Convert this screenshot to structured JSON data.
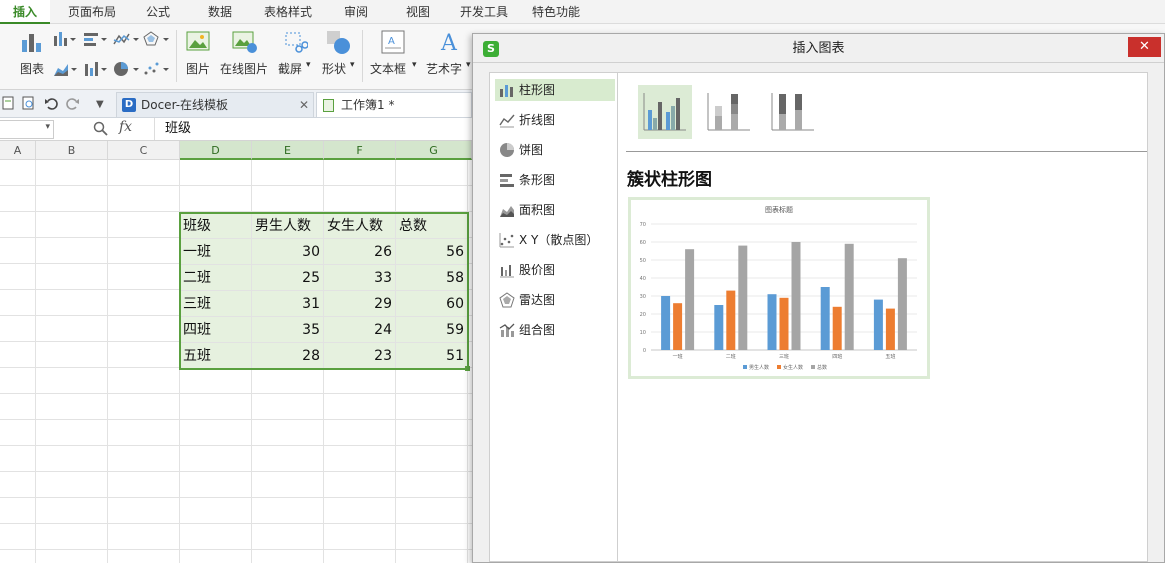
{
  "menu_tabs": [
    "插入",
    "页面布局",
    "公式",
    "数据",
    "表格样式",
    "审阅",
    "视图",
    "开发工具",
    "特色功能"
  ],
  "ribbon": {
    "chart_label": "图表",
    "picture_label": "图片",
    "online_picture_label": "在线图片",
    "screenshot_label": "截屏",
    "shapes_label": "形状",
    "textbox_label": "文本框",
    "wordart_label": "艺术字"
  },
  "file_tabs": {
    "docer": "Docer-在线模板",
    "workbook": "工作簿1 *"
  },
  "formula": {
    "fx": "fx",
    "value": "班级"
  },
  "column_headers": [
    "A",
    "B",
    "C",
    "D",
    "E",
    "F",
    "G"
  ],
  "table": {
    "headers": [
      "班级",
      "男生人数",
      "女生人数",
      "总数"
    ],
    "rows": [
      [
        "一班",
        "30",
        "26",
        "56"
      ],
      [
        "二班",
        "25",
        "33",
        "58"
      ],
      [
        "三班",
        "31",
        "29",
        "60"
      ],
      [
        "四班",
        "35",
        "24",
        "59"
      ],
      [
        "五班",
        "28",
        "23",
        "51"
      ]
    ]
  },
  "dialog": {
    "title": "插入图表",
    "chart_types": [
      "柱形图",
      "折线图",
      "饼图",
      "条形图",
      "面积图",
      "X Y（散点图）",
      "股价图",
      "雷达图",
      "组合图"
    ],
    "selected_type_index": 0,
    "subtype_title": "簇状柱形图",
    "close_icon": "close-icon"
  },
  "chart_data": {
    "type": "bar",
    "title": "图表标题",
    "categories": [
      "一班",
      "二班",
      "三班",
      "四班",
      "五班"
    ],
    "series": [
      {
        "name": "男生人数",
        "values": [
          30,
          25,
          31,
          35,
          28
        ]
      },
      {
        "name": "女生人数",
        "values": [
          26,
          33,
          29,
          24,
          23
        ]
      },
      {
        "name": "总数",
        "values": [
          56,
          58,
          60,
          59,
          51
        ]
      }
    ],
    "ylim": [
      0,
      70
    ],
    "yticks": [
      "0",
      "10",
      "20",
      "30",
      "40",
      "50",
      "60",
      "70"
    ],
    "grid": true,
    "legend": "bottom",
    "colors": [
      "#5b9bd5",
      "#ed7d31",
      "#a5a5a5"
    ]
  },
  "colors": {
    "accent": "#3a8a28",
    "selection_fill": "#e6f1df",
    "selection_border": "#5aa03f",
    "close_button": "#c9302c"
  }
}
